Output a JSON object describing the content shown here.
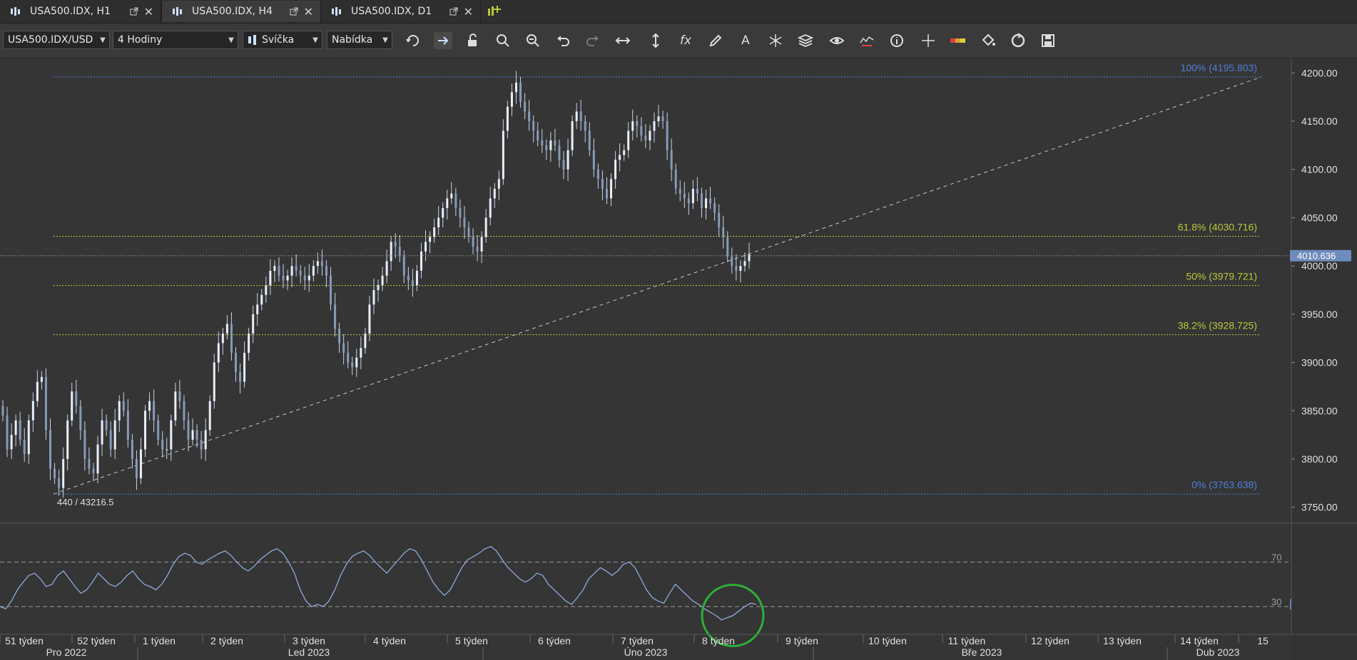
{
  "tabs": [
    {
      "label": "USA500.IDX, H1",
      "active": false
    },
    {
      "label": "USA500.IDX, H4",
      "active": true
    },
    {
      "label": "USA500.IDX, D1",
      "active": false
    }
  ],
  "toolbar": {
    "instrument": "USA500.IDX/USD",
    "period": "4 Hodiny",
    "chart_style": "Svíčka",
    "offer_side": "Nabídka",
    "tools": [
      "refresh-icon",
      "autoshift-icon",
      "lock-icon",
      "zoom-in-icon",
      "zoom-out-icon",
      "undo-icon",
      "redo-icon",
      "horizontal-resize-icon",
      "vertical-resize-icon",
      "formula-icon",
      "pencil-icon",
      "text-icon",
      "pattern-icon",
      "layers-icon",
      "eye-icon",
      "indicator-icon",
      "info-icon",
      "crosshair-icon",
      "color-bar-icon",
      "paint-bucket-icon",
      "circle-arrow-icon",
      "save-icon"
    ]
  },
  "chart_data": {
    "type": "candlestick",
    "instrument": "USA500.IDX, H4",
    "ylim": [
      3735,
      4215
    ],
    "y_ticks": [
      "4200.00",
      "4150.00",
      "4100.00",
      "4050.00",
      "4000.00",
      "3950.00",
      "3900.00",
      "3850.00",
      "3800.00",
      "3750.00"
    ],
    "current_price": "4010.636",
    "fibonacci": [
      {
        "label": "100% (4195.803)",
        "value": 4195.803,
        "color": "#4f7fd6"
      },
      {
        "label": "61.8% (4030.716)",
        "value": 4030.716,
        "color": "#b9c83a"
      },
      {
        "label": "50% (3979.721)",
        "value": 3979.721,
        "color": "#b9c83a"
      },
      {
        "label": "38.2% (3928.725)",
        "value": 3928.725,
        "color": "#b9c83a"
      },
      {
        "label": "0% (3763.638)",
        "value": 3763.638,
        "color": "#4f7fd6"
      }
    ],
    "trendline": {
      "from": 3763.638,
      "to": 4195.803
    },
    "low_annotation": "440 / 43216.5",
    "series_close": [
      3845,
      3810,
      3825,
      3840,
      3820,
      3805,
      3840,
      3860,
      3880,
      3885,
      3830,
      3790,
      3780,
      3770,
      3800,
      3840,
      3870,
      3855,
      3830,
      3800,
      3790,
      3785,
      3815,
      3840,
      3830,
      3810,
      3840,
      3860,
      3850,
      3820,
      3800,
      3780,
      3810,
      3850,
      3860,
      3840,
      3820,
      3810,
      3810,
      3840,
      3870,
      3860,
      3840,
      3820,
      3830,
      3820,
      3810,
      3830,
      3860,
      3900,
      3920,
      3930,
      3940,
      3910,
      3890,
      3880,
      3910,
      3930,
      3950,
      3960,
      3970,
      3980,
      3995,
      4000,
      3990,
      3985,
      3990,
      4000,
      3995,
      3990,
      3985,
      3990,
      4000,
      4005,
      4000,
      3990,
      3960,
      3935,
      3920,
      3910,
      3900,
      3895,
      3905,
      3915,
      3930,
      3960,
      3975,
      3980,
      3990,
      4005,
      4025,
      4020,
      4010,
      3990,
      3985,
      3980,
      3995,
      4015,
      4025,
      4030,
      4040,
      4050,
      4060,
      4070,
      4075,
      4060,
      4050,
      4040,
      4030,
      4020,
      4015,
      4030,
      4050,
      4070,
      4080,
      4090,
      4140,
      4165,
      4180,
      4190,
      4170,
      4160,
      4150,
      4140,
      4130,
      4125,
      4120,
      4130,
      4125,
      4110,
      4100,
      4120,
      4150,
      4160,
      4150,
      4140,
      4120,
      4100,
      4090,
      4080,
      4070,
      4090,
      4110,
      4115,
      4120,
      4140,
      4150,
      4145,
      4135,
      4130,
      4140,
      4150,
      4155,
      4150,
      4120,
      4100,
      4080,
      4075,
      4070,
      4065,
      4080,
      4075,
      4060,
      4070,
      4065,
      4055,
      4040,
      4030,
      4010,
      4000,
      3995,
      4000,
      4005,
      4012
    ],
    "oscillator": {
      "ylim": [
        5,
        105
      ],
      "y_ticks": [
        "98.654",
        "73.171",
        "47.687",
        "22.204"
      ],
      "levels": [
        70,
        30
      ],
      "current": "32.025",
      "values": [
        30,
        28,
        35,
        45,
        52,
        58,
        60,
        55,
        48,
        50,
        58,
        62,
        55,
        48,
        42,
        45,
        52,
        60,
        55,
        50,
        48,
        52,
        58,
        62,
        55,
        50,
        48,
        45,
        50,
        58,
        68,
        75,
        78,
        76,
        70,
        68,
        72,
        75,
        78,
        80,
        76,
        70,
        65,
        62,
        66,
        72,
        76,
        80,
        82,
        78,
        70,
        60,
        45,
        35,
        30,
        32,
        30,
        35,
        45,
        58,
        68,
        75,
        78,
        80,
        76,
        70,
        65,
        60,
        66,
        72,
        78,
        82,
        80,
        72,
        62,
        52,
        45,
        40,
        45,
        55,
        65,
        72,
        75,
        78,
        82,
        84,
        80,
        72,
        65,
        60,
        55,
        52,
        55,
        60,
        58,
        50,
        45,
        40,
        35,
        32,
        38,
        45,
        55,
        60,
        65,
        62,
        58,
        62,
        68,
        70,
        65,
        55,
        45,
        38,
        35,
        33,
        42,
        50,
        45,
        40,
        35,
        32,
        28,
        25,
        22,
        18,
        20,
        22,
        26,
        30,
        33,
        32
      ]
    },
    "x_weeks": [
      "51 týden",
      "52 týden",
      "1 týden",
      "2 týden",
      "3 týden",
      "4 týden",
      "5 týden",
      "6 týden",
      "7 týden",
      "8 týden",
      "9 týden",
      "10 týden",
      "11 týden",
      "12 týden",
      "13 týden",
      "14 týden",
      "15"
    ],
    "x_months": [
      "Pro 2022",
      "Led 2023",
      "Úno 2023",
      "Bře 2023",
      "Dub 2023"
    ],
    "highlight": "circle"
  }
}
